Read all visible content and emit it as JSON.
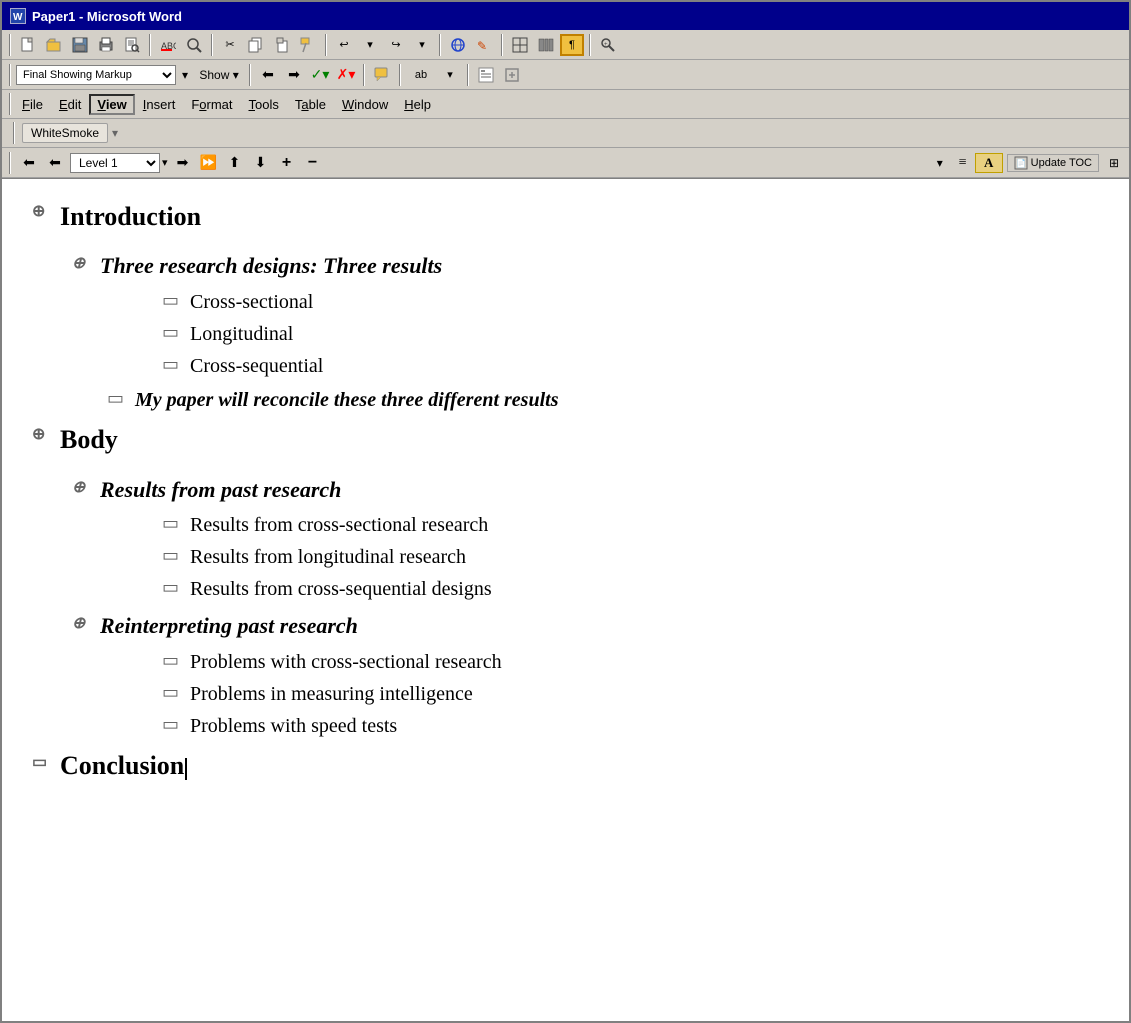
{
  "window": {
    "title": "Paper1 - Microsoft Word",
    "icon_label": "W"
  },
  "toolbar1": {
    "dropdown_value": "Final Showing Markup",
    "show_label": "Show ▾"
  },
  "menubar": {
    "items": [
      {
        "id": "file",
        "label": "File",
        "underline_index": 0
      },
      {
        "id": "edit",
        "label": "Edit",
        "underline_index": 0
      },
      {
        "id": "view",
        "label": "View",
        "underline_index": 0,
        "active": true
      },
      {
        "id": "insert",
        "label": "Insert",
        "underline_index": 0
      },
      {
        "id": "format",
        "label": "Format",
        "underline_index": 0
      },
      {
        "id": "tools",
        "label": "Tools",
        "underline_index": 0
      },
      {
        "id": "table",
        "label": "Table",
        "underline_index": 0
      },
      {
        "id": "window",
        "label": "Window",
        "underline_index": 0
      },
      {
        "id": "help",
        "label": "Help",
        "underline_index": 0
      }
    ]
  },
  "whitesmoke": {
    "label": "WhiteSmoke"
  },
  "outline_toolbar": {
    "level_dropdown": "Level 1",
    "update_toc_label": "Update TOC"
  },
  "document": {
    "heading1_intro": "Introduction",
    "heading2_research": "Three research designs: Three results",
    "item_cross_sectional": "Cross-sectional",
    "item_longitudinal": "Longitudinal",
    "item_cross_sequential": "Cross-sequential",
    "item_reconcile": "My paper will reconcile these three different results",
    "heading1_body": "Body",
    "heading2_results": "Results from past research",
    "item_results_cross": "Results from cross-sectional research",
    "item_results_longitudinal": "Results from longitudinal research",
    "item_results_cross_seq": "Results from cross-sequential designs",
    "heading2_reinterp": "Reinterpreting past research",
    "item_problems_cross": "Problems with cross-sectional research",
    "item_problems_measuring": "Problems in measuring intelligence",
    "item_problems_speed": "Problems with speed tests",
    "heading1_conclusion": "Conclusion"
  }
}
